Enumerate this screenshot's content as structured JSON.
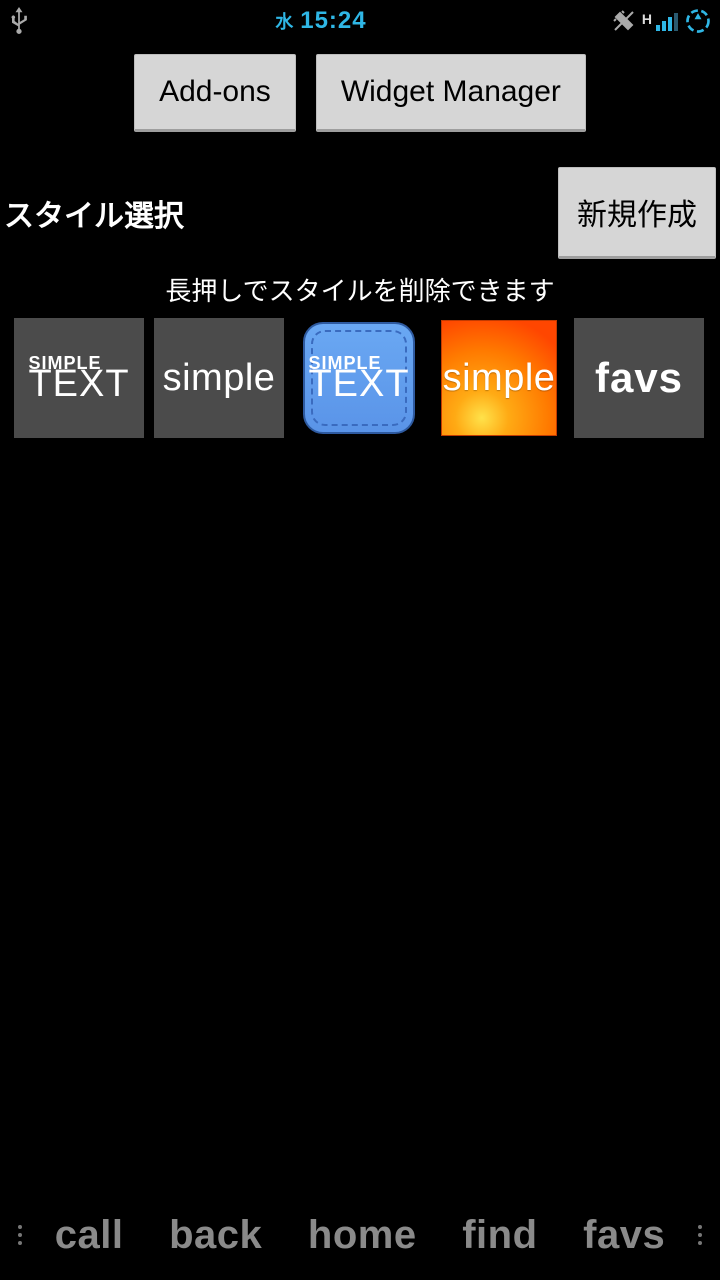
{
  "status_bar": {
    "day_char": "水",
    "time": "15:24",
    "h_indicator": "H"
  },
  "top_buttons": {
    "addons_label": "Add-ons",
    "widget_manager_label": "Widget Manager"
  },
  "section": {
    "title": "スタイル選択",
    "new_label": "新規作成"
  },
  "hint_text": "長押しでスタイルを削除できます",
  "tiles": {
    "simpletext_l1": "SIMPLE",
    "simpletext_l2": "TEXT",
    "simple_label": "simple",
    "favs_label": "favs"
  },
  "softkeys": {
    "items": [
      "call",
      "back",
      "home",
      "find",
      "favs"
    ]
  }
}
